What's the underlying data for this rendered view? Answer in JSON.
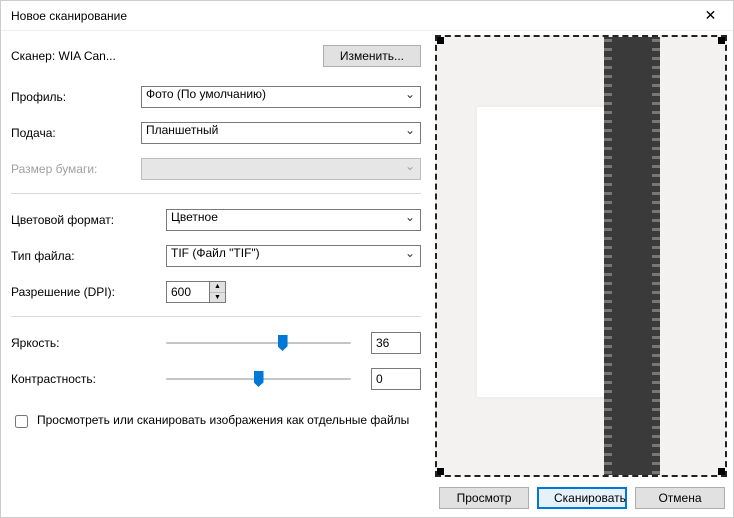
{
  "window": {
    "title": "Новое сканирование"
  },
  "scanner": {
    "label": "Сканер: WIA Can...",
    "change_btn": "Изменить..."
  },
  "profile": {
    "label": "Профиль:",
    "value": "Фото (По умолчанию)"
  },
  "source": {
    "label": "Подача:",
    "value": "Планшетный"
  },
  "paper_size": {
    "label": "Размер бумаги:",
    "value": ""
  },
  "color_format": {
    "label": "Цветовой формат:",
    "value": "Цветное"
  },
  "file_type": {
    "label": "Тип файла:",
    "value": "TIF (Файл \"TIF\")"
  },
  "dpi": {
    "label": "Разрешение (DPI):",
    "value": "600"
  },
  "brightness": {
    "label": "Яркость:",
    "value": "36",
    "pos_pct": 63
  },
  "contrast": {
    "label": "Контрастность:",
    "value": "0",
    "pos_pct": 50
  },
  "separate_files": {
    "label": "Просмотреть или сканировать изображения как отдельные файлы"
  },
  "buttons": {
    "preview": "Просмотр",
    "scan": "Сканировать",
    "cancel": "Отмена"
  }
}
